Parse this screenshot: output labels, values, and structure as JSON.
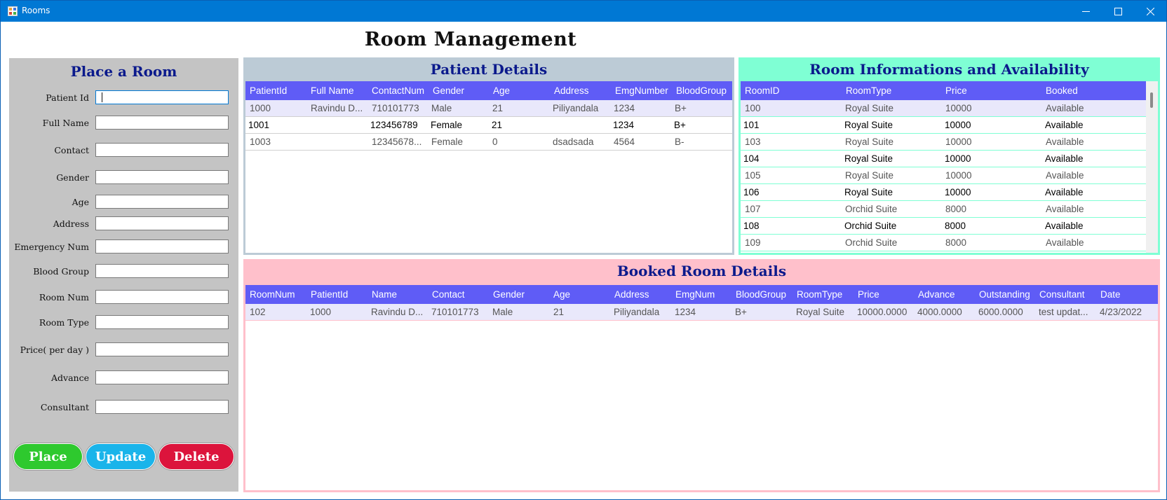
{
  "window": {
    "title": "Rooms",
    "accent": "#0078d4"
  },
  "page_title": "Room Management",
  "form": {
    "title": "Place a Room",
    "fields": [
      {
        "label": "Patient Id",
        "value": ""
      },
      {
        "label": "Full Name",
        "value": ""
      },
      {
        "label": "Contact",
        "value": ""
      },
      {
        "label": "Gender",
        "value": ""
      },
      {
        "label": "Age",
        "value": ""
      },
      {
        "label": "Address",
        "value": ""
      },
      {
        "label": "Emergency Num",
        "value": ""
      },
      {
        "label": "Blood Group",
        "value": ""
      },
      {
        "label": "Room Num",
        "value": ""
      },
      {
        "label": "Room Type",
        "value": ""
      },
      {
        "label": "Price( per day )",
        "value": ""
      },
      {
        "label": "Advance",
        "value": ""
      },
      {
        "label": "Consultant",
        "value": ""
      }
    ],
    "buttons": {
      "place": "Place",
      "update": "Update",
      "delete": "Delete"
    }
  },
  "patient": {
    "title": "Patient Details",
    "columns": [
      "PatientId",
      "Full Name",
      "ContactNum",
      "Gender",
      "Age",
      "Address",
      "EmgNumber",
      "BloodGroup"
    ],
    "rows": [
      [
        "1000",
        "Ravindu D...",
        "710101773",
        "Male",
        "21",
        "Piliyandala",
        "1234",
        "B+"
      ],
      [
        "1001",
        "",
        "123456789",
        "Female",
        "21",
        "",
        "1234",
        "B+"
      ],
      [
        "1003",
        "",
        "12345678...",
        "Female",
        "0",
        "dsadsada",
        "4564",
        "B-"
      ]
    ]
  },
  "rooms": {
    "title": "Room Informations and Availability",
    "columns": [
      "RoomID",
      "RoomType",
      "Price",
      "Booked"
    ],
    "rows": [
      [
        "100",
        "Royal Suite",
        "10000",
        "Available"
      ],
      [
        "101",
        "Royal Suite",
        "10000",
        "Available"
      ],
      [
        "103",
        "Royal Suite",
        "10000",
        "Available"
      ],
      [
        "104",
        "Royal Suite",
        "10000",
        "Available"
      ],
      [
        "105",
        "Royal Suite",
        "10000",
        "Available"
      ],
      [
        "106",
        "Royal Suite",
        "10000",
        "Available"
      ],
      [
        "107",
        "Orchid Suite",
        "8000",
        "Available"
      ],
      [
        "108",
        "Orchid Suite",
        "8000",
        "Available"
      ],
      [
        "109",
        "Orchid Suite",
        "8000",
        "Available"
      ]
    ]
  },
  "booked": {
    "title": "Booked Room Details",
    "columns": [
      "RoomNum",
      "PatientId",
      "Name",
      "Contact",
      "Gender",
      "Age",
      "Address",
      "EmgNum",
      "BloodGroup",
      "RoomType",
      "Price",
      "Advance",
      "Outstanding",
      "Consultant",
      "Date"
    ],
    "rows": [
      [
        "102",
        "1000",
        "Ravindu D...",
        "710101773",
        "Male",
        "21",
        "Piliyandala",
        "1234",
        "B+",
        "Royal Suite",
        "10000.0000",
        "4000.0000",
        "6000.0000",
        "test updat...",
        "4/23/2022"
      ]
    ]
  }
}
